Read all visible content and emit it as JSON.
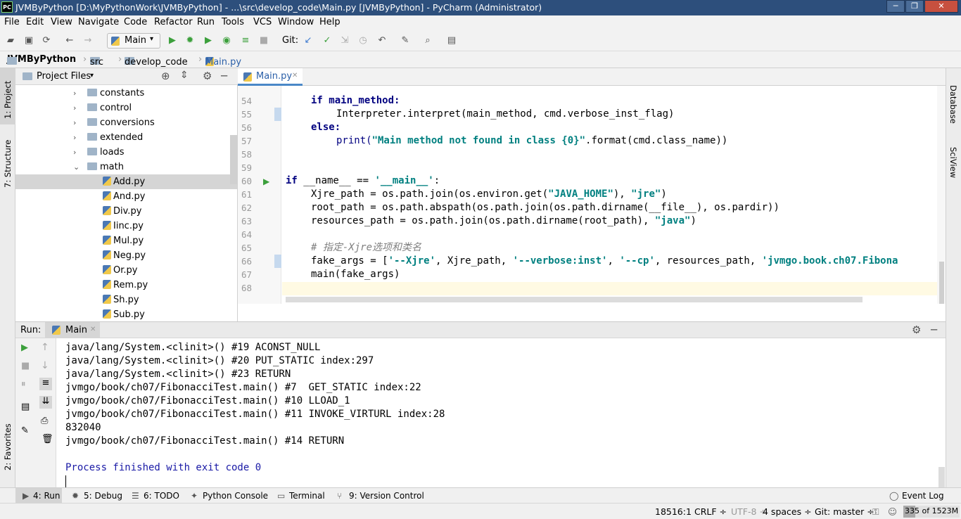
{
  "window": {
    "title": "JVMByPython [D:\\MyPythonWork\\JVMByPython] - ...\\src\\develop_code\\Main.py [JVMByPython] - PyCharm (Administrator)",
    "logo": "PC"
  },
  "menu": [
    "File",
    "Edit",
    "View",
    "Navigate",
    "Code",
    "Refactor",
    "Run",
    "Tools",
    "VCS",
    "Window",
    "Help"
  ],
  "toolbar": {
    "run_config": "Main",
    "git_label": "Git:"
  },
  "breadcrumb": [
    "JVMByPython",
    "src",
    "develop_code",
    "Main.py"
  ],
  "left_strip": {
    "project": "1: Project",
    "structure": "7: Structure",
    "favorites": "2: Favorites"
  },
  "right_strip": {
    "database": "Database",
    "sciview": "SciView"
  },
  "project_panel": {
    "title": "Project Files",
    "folders": [
      "constants",
      "control",
      "conversions",
      "extended",
      "loads",
      "math"
    ],
    "files": [
      "Add.py",
      "And.py",
      "Div.py",
      "Iinc.py",
      "Mul.py",
      "Neg.py",
      "Or.py",
      "Rem.py",
      "Sh.py",
      "Sub.py"
    ],
    "selected_file": "Add.py"
  },
  "editor": {
    "tab": "Main.py",
    "line_numbers": [
      "54",
      "55",
      "56",
      "57",
      "58",
      "59",
      "60",
      "61",
      "62",
      "63",
      "64",
      "65",
      "66",
      "67",
      "68"
    ],
    "lines": {
      "l54": "if main_method:",
      "l55": "Interpreter.interpret(main_method, cmd.verbose_inst_flag)",
      "l56": "else:",
      "l57a": "print(",
      "l57b": "\"Main method not found in class {0}\"",
      "l57c": ".format(cmd.class_name))",
      "l60a": "if",
      "l60b": " __name__ == ",
      "l60c": "'__main__'",
      "l60d": ":",
      "l61a": "Xjre_path = os.path.join(os.environ.get(",
      "l61b": "\"JAVA_HOME\"",
      "l61c": "), ",
      "l61d": "\"jre\"",
      "l61e": ")",
      "l62": "root_path = os.path.abspath(os.path.join(os.path.dirname(__file__), os.pardir))",
      "l63a": "resources_path = os.path.join(os.path.dirname(root_path), ",
      "l63b": "\"java\"",
      "l63c": ")",
      "l65": "# 指定-Xjre选项和类名",
      "l66a": "fake_args = [",
      "l66b": "'--Xjre'",
      "l66c": ", Xjre_path, ",
      "l66d": "'--verbose:inst'",
      "l66e": ", ",
      "l66f": "'--cp'",
      "l66g": ", resources_path, ",
      "l66h": "'jvmgo.book.ch07.Fibona",
      "l67": "main(fake_args)"
    }
  },
  "run_panel": {
    "label": "Run:",
    "tab": "Main",
    "output": [
      "java/lang/System.<clinit>() #19 ACONST_NULL",
      "java/lang/System.<clinit>() #20 PUT_STATIC index:297",
      "java/lang/System.<clinit>() #23 RETURN",
      "jvmgo/book/ch07/FibonacciTest.main() #7  GET_STATIC index:22",
      "jvmgo/book/ch07/FibonacciTest.main() #10 LLOAD_1",
      "jvmgo/book/ch07/FibonacciTest.main() #11 INVOKE_VIRTURL index:28",
      "832040",
      "jvmgo/book/ch07/FibonacciTest.main() #14 RETURN"
    ],
    "finished": "Process finished with exit code 0"
  },
  "bottom_tabs": [
    "4: Run",
    "5: Debug",
    "6: TODO",
    "Python Console",
    "Terminal",
    "9: Version Control"
  ],
  "event_log": "Event Log",
  "status": {
    "position": "18516:1",
    "line_sep": "CRLF ÷",
    "encoding": "UTF-8 ÷",
    "indent": "4 spaces ÷",
    "git": "Git: master ÷",
    "memory": "335 of 1523M"
  }
}
